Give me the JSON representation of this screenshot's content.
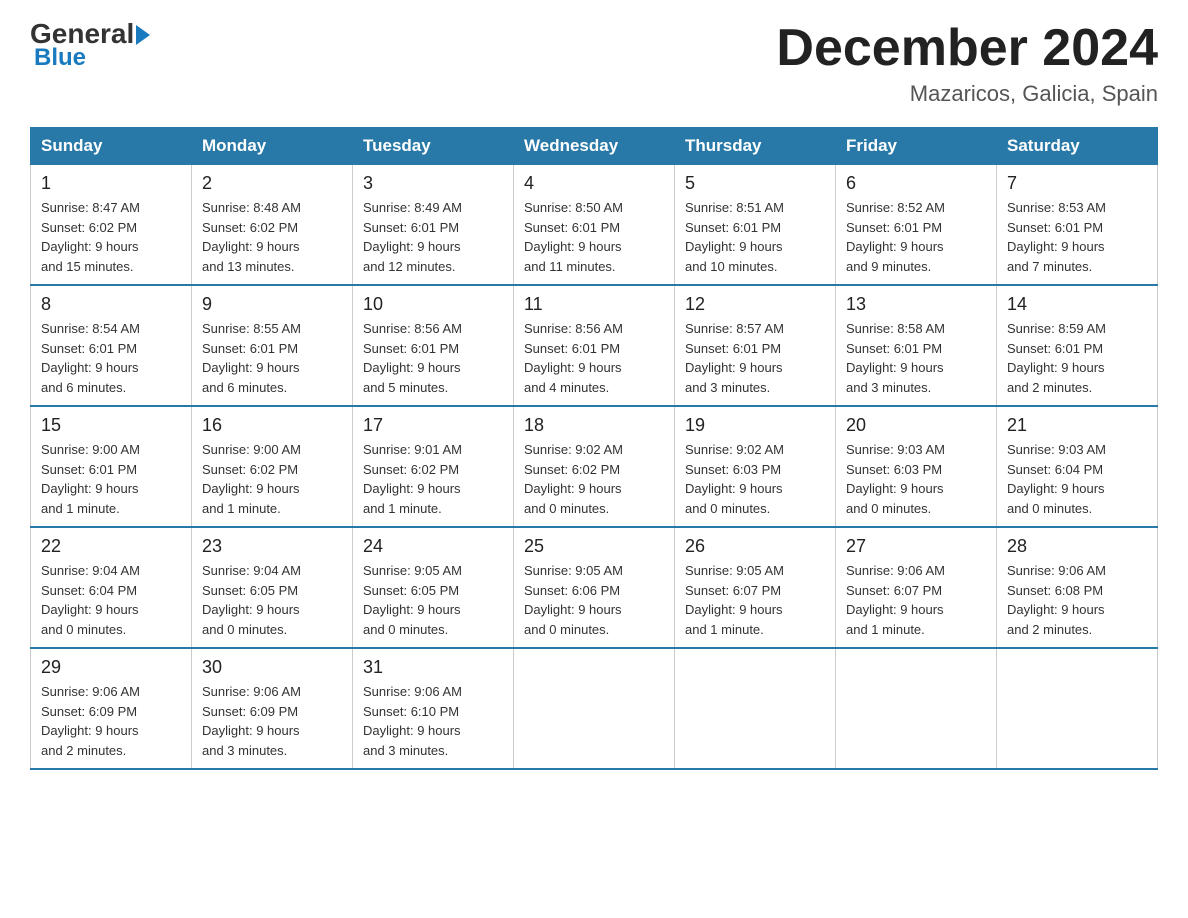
{
  "header": {
    "month_title": "December 2024",
    "location": "Mazaricos, Galicia, Spain",
    "logo_general": "General",
    "logo_blue": "Blue"
  },
  "days_of_week": [
    "Sunday",
    "Monday",
    "Tuesday",
    "Wednesday",
    "Thursday",
    "Friday",
    "Saturday"
  ],
  "weeks": [
    [
      {
        "day": "1",
        "sunrise": "8:47 AM",
        "sunset": "6:02 PM",
        "daylight": "9 hours and 15 minutes."
      },
      {
        "day": "2",
        "sunrise": "8:48 AM",
        "sunset": "6:02 PM",
        "daylight": "9 hours and 13 minutes."
      },
      {
        "day": "3",
        "sunrise": "8:49 AM",
        "sunset": "6:01 PM",
        "daylight": "9 hours and 12 minutes."
      },
      {
        "day": "4",
        "sunrise": "8:50 AM",
        "sunset": "6:01 PM",
        "daylight": "9 hours and 11 minutes."
      },
      {
        "day": "5",
        "sunrise": "8:51 AM",
        "sunset": "6:01 PM",
        "daylight": "9 hours and 10 minutes."
      },
      {
        "day": "6",
        "sunrise": "8:52 AM",
        "sunset": "6:01 PM",
        "daylight": "9 hours and 9 minutes."
      },
      {
        "day": "7",
        "sunrise": "8:53 AM",
        "sunset": "6:01 PM",
        "daylight": "9 hours and 7 minutes."
      }
    ],
    [
      {
        "day": "8",
        "sunrise": "8:54 AM",
        "sunset": "6:01 PM",
        "daylight": "9 hours and 6 minutes."
      },
      {
        "day": "9",
        "sunrise": "8:55 AM",
        "sunset": "6:01 PM",
        "daylight": "9 hours and 6 minutes."
      },
      {
        "day": "10",
        "sunrise": "8:56 AM",
        "sunset": "6:01 PM",
        "daylight": "9 hours and 5 minutes."
      },
      {
        "day": "11",
        "sunrise": "8:56 AM",
        "sunset": "6:01 PM",
        "daylight": "9 hours and 4 minutes."
      },
      {
        "day": "12",
        "sunrise": "8:57 AM",
        "sunset": "6:01 PM",
        "daylight": "9 hours and 3 minutes."
      },
      {
        "day": "13",
        "sunrise": "8:58 AM",
        "sunset": "6:01 PM",
        "daylight": "9 hours and 3 minutes."
      },
      {
        "day": "14",
        "sunrise": "8:59 AM",
        "sunset": "6:01 PM",
        "daylight": "9 hours and 2 minutes."
      }
    ],
    [
      {
        "day": "15",
        "sunrise": "9:00 AM",
        "sunset": "6:01 PM",
        "daylight": "9 hours and 1 minute."
      },
      {
        "day": "16",
        "sunrise": "9:00 AM",
        "sunset": "6:02 PM",
        "daylight": "9 hours and 1 minute."
      },
      {
        "day": "17",
        "sunrise": "9:01 AM",
        "sunset": "6:02 PM",
        "daylight": "9 hours and 1 minute."
      },
      {
        "day": "18",
        "sunrise": "9:02 AM",
        "sunset": "6:02 PM",
        "daylight": "9 hours and 0 minutes."
      },
      {
        "day": "19",
        "sunrise": "9:02 AM",
        "sunset": "6:03 PM",
        "daylight": "9 hours and 0 minutes."
      },
      {
        "day": "20",
        "sunrise": "9:03 AM",
        "sunset": "6:03 PM",
        "daylight": "9 hours and 0 minutes."
      },
      {
        "day": "21",
        "sunrise": "9:03 AM",
        "sunset": "6:04 PM",
        "daylight": "9 hours and 0 minutes."
      }
    ],
    [
      {
        "day": "22",
        "sunrise": "9:04 AM",
        "sunset": "6:04 PM",
        "daylight": "9 hours and 0 minutes."
      },
      {
        "day": "23",
        "sunrise": "9:04 AM",
        "sunset": "6:05 PM",
        "daylight": "9 hours and 0 minutes."
      },
      {
        "day": "24",
        "sunrise": "9:05 AM",
        "sunset": "6:05 PM",
        "daylight": "9 hours and 0 minutes."
      },
      {
        "day": "25",
        "sunrise": "9:05 AM",
        "sunset": "6:06 PM",
        "daylight": "9 hours and 0 minutes."
      },
      {
        "day": "26",
        "sunrise": "9:05 AM",
        "sunset": "6:07 PM",
        "daylight": "9 hours and 1 minute."
      },
      {
        "day": "27",
        "sunrise": "9:06 AM",
        "sunset": "6:07 PM",
        "daylight": "9 hours and 1 minute."
      },
      {
        "day": "28",
        "sunrise": "9:06 AM",
        "sunset": "6:08 PM",
        "daylight": "9 hours and 2 minutes."
      }
    ],
    [
      {
        "day": "29",
        "sunrise": "9:06 AM",
        "sunset": "6:09 PM",
        "daylight": "9 hours and 2 minutes."
      },
      {
        "day": "30",
        "sunrise": "9:06 AM",
        "sunset": "6:09 PM",
        "daylight": "9 hours and 3 minutes."
      },
      {
        "day": "31",
        "sunrise": "9:06 AM",
        "sunset": "6:10 PM",
        "daylight": "9 hours and 3 minutes."
      },
      null,
      null,
      null,
      null
    ]
  ],
  "labels": {
    "sunrise": "Sunrise:",
    "sunset": "Sunset:",
    "daylight": "Daylight:"
  }
}
